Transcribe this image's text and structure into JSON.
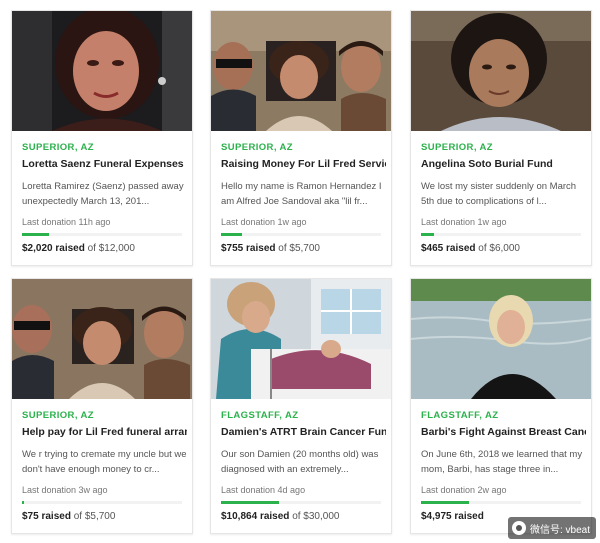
{
  "campaigns": [
    {
      "location": "SUPERIOR, AZ",
      "title": "Loretta Saenz Funeral Expenses",
      "desc": "Loretta Ramirez (Saenz) passed away unexpectedly March 13, 201...",
      "last_donation": "Last donation 11h ago",
      "raised": "$2,020",
      "raised_label": "raised",
      "goal": "of $12,000",
      "progress": 0.17,
      "image": "woman-portrait-photo"
    },
    {
      "location": "SUPERIOR, AZ",
      "title": "Raising Money For Lil Fred Services",
      "desc": "Hello my name is Ramon Hernandez I am Alfred Joe Sandoval aka \"lil fr...",
      "last_donation": "Last donation 1w ago",
      "raised": "$755",
      "raised_label": "raised",
      "goal": "of $5,700",
      "progress": 0.13,
      "image": "group-photo"
    },
    {
      "location": "SUPERIOR, AZ",
      "title": "Angelina Soto Burial Fund",
      "desc": "We lost my sister suddenly on March 5th due to complications of l...",
      "last_donation": "Last donation 1w ago",
      "raised": "$465",
      "raised_label": "raised",
      "goal": "of $6,000",
      "progress": 0.08,
      "image": "woman-portrait-photo"
    },
    {
      "location": "SUPERIOR, AZ",
      "title": "Help pay for Lil Fred funeral arran...",
      "desc": "We r trying to cremate my uncle but we don't have enough money to cr...",
      "last_donation": "Last donation 3w ago",
      "raised": "$75",
      "raised_label": "raised",
      "goal": "of $5,700",
      "progress": 0.013,
      "image": "group-photo"
    },
    {
      "location": "FLAGSTAFF, AZ",
      "title": "Damien's ATRT Brain Cancer Fund",
      "desc": "Our son Damien (20 months old) was diagnosed with an extremely...",
      "last_donation": "Last donation 4d ago",
      "raised": "$10,864",
      "raised_label": "raised",
      "goal": "of $30,000",
      "progress": 0.36,
      "image": "hospital-photo"
    },
    {
      "location": "FLAGSTAFF, AZ",
      "title": "Barbi's Fight Against Breast Cancer",
      "desc": "On June 6th, 2018 we learned that my mom, Barbi, has stage three in...",
      "last_donation": "Last donation 2w ago",
      "raised": "$4,975",
      "raised_label": "raised",
      "goal": "",
      "progress": 0.3,
      "image": "woman-lake-photo"
    }
  ],
  "watermark": {
    "text": "微信号: vbeat"
  },
  "colors": {
    "accent": "#2bb24c"
  }
}
